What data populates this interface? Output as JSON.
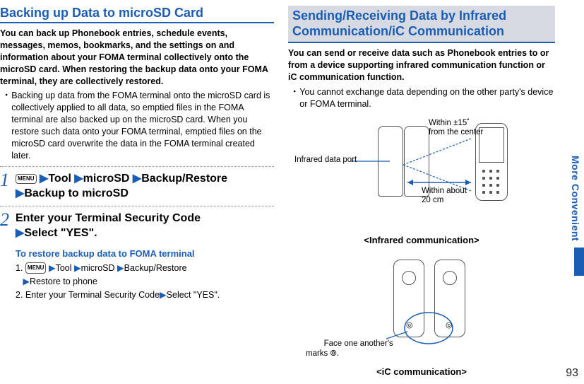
{
  "pageNumber": "93",
  "sideLabel": "More Convenient",
  "left": {
    "heading": "Backing up Data to microSD Card",
    "intro": "You can back up Phonebook entries, schedule events, messages, memos, bookmarks, and the settings on and information about your FOMA terminal collectively onto the microSD card. When restoring the backup data onto your FOMA terminal, they are collectively restored.",
    "bullet": "Backing up data from the FOMA terminal onto the microSD card is collectively applied to all data, so emptied files in the FOMA terminal are also backed up on the microSD card. When you restore such data onto your FOMA terminal, emptied files on the microSD card overwrite the data in the FOMA terminal created later.",
    "menuLabel": "MENU",
    "chev": "▶",
    "step1": {
      "parts": [
        "Tool",
        "microSD",
        "Backup/Restore",
        "Backup to microSD"
      ]
    },
    "step2": {
      "line1": "Enter your Terminal Security Code",
      "line2": "Select \"YES\"."
    },
    "restore": {
      "heading": "To restore backup data to FOMA terminal",
      "step1parts": [
        "Tool",
        "microSD",
        "Backup/Restore",
        "Restore to phone"
      ],
      "step2": "Enter your Terminal Security Code",
      "step2b": "Select \"YES\"."
    }
  },
  "right": {
    "heading": "Sending/Receiving Data by Infrared Communication/iC Communication",
    "intro": "You can send or receive data such as Phonebook entries to or from a device supporting infrared communication function or iC communication function.",
    "bullet": "You cannot exchange data depending on the other party's device or FOMA terminal.",
    "labels": {
      "irPort": "Infrared data port",
      "angle": "Within ±15˚\nfrom the center",
      "distance": "Within about\n20 cm",
      "face": "Face one another's\nmarks "
    },
    "caption1": "<Infrared communication>",
    "caption2": "<iC communication>"
  }
}
